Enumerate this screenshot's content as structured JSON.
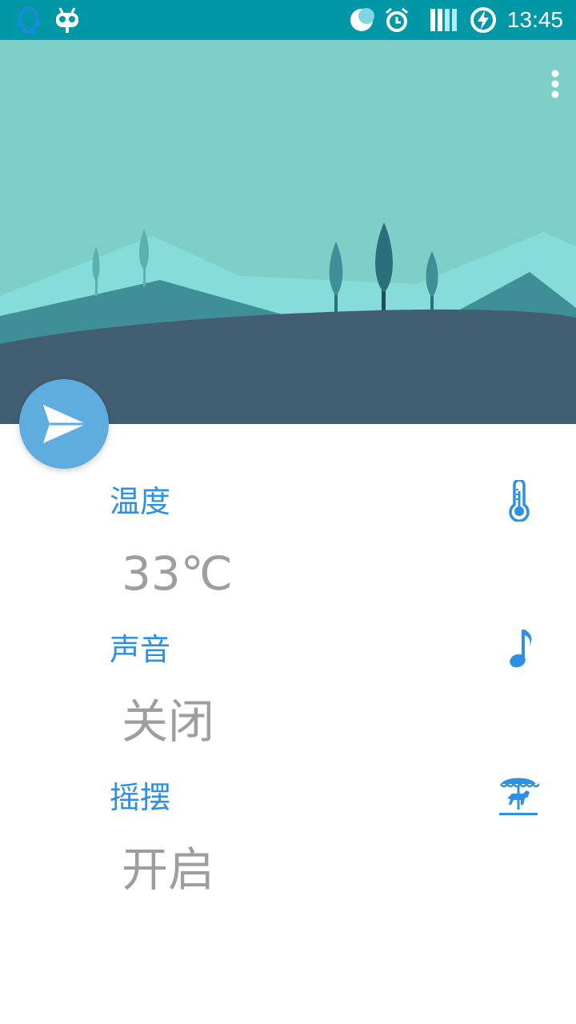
{
  "status_bar": {
    "time": "13:45",
    "icons": [
      "qq-icon",
      "robot-icon",
      "moon-icon",
      "alarm-icon",
      "signal-icon",
      "battery-charging-icon"
    ],
    "background": "#0097a7"
  },
  "hero": {
    "sky_color": "#7ecfc8",
    "ground_color": "#415e73"
  },
  "fab": {
    "icon": "send-icon",
    "color": "#5eadde"
  },
  "items": [
    {
      "label": "温度",
      "value": "33℃",
      "icon": "thermometer-icon"
    },
    {
      "label": "声音",
      "value": "关闭",
      "icon": "music-note-icon"
    },
    {
      "label": "摇摆",
      "value": "开启",
      "icon": "carousel-icon"
    }
  ],
  "accent_color": "#2f8fe0",
  "value_color": "#9e9e9e"
}
